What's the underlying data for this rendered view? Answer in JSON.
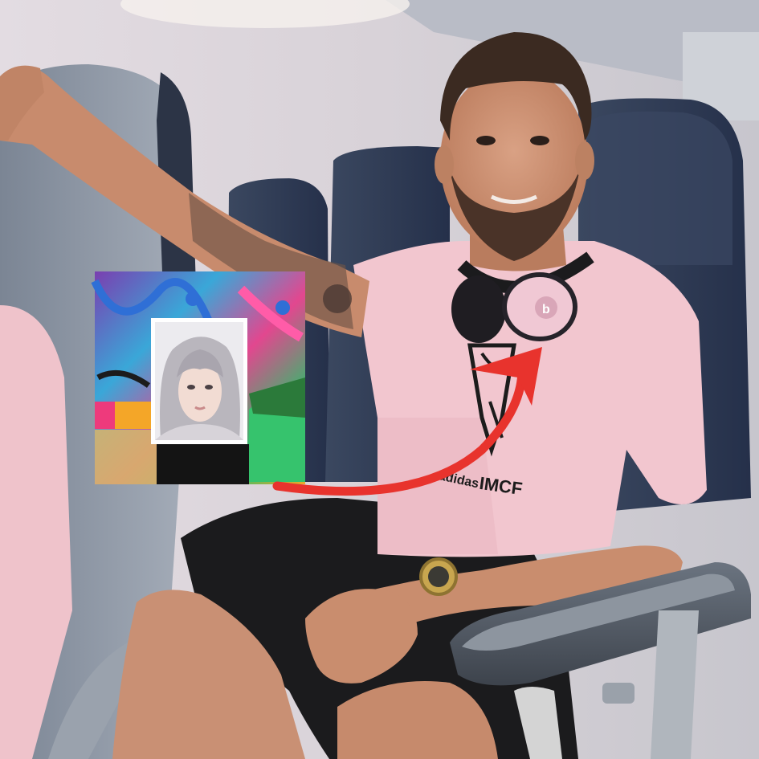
{
  "photo": {
    "shirt_brand": "adidas",
    "shirt_club": "IMCF",
    "headphones_logo": "b"
  },
  "colors": {
    "cabin_wall": "#dcd6dc",
    "seat_navy": "#2d3a50",
    "seat_gray": "#8c96a4",
    "shirt_pink": "#f2c6cf",
    "shorts_black": "#1b1b1d",
    "skin": "#c98d6e",
    "headphones_pink": "#f0c8d4",
    "arrow_red": "#e8332d",
    "inset_border": "#ffffff"
  },
  "icons": [
    "curved-arrow-icon",
    "beats-logo-icon",
    "watch-icon"
  ]
}
